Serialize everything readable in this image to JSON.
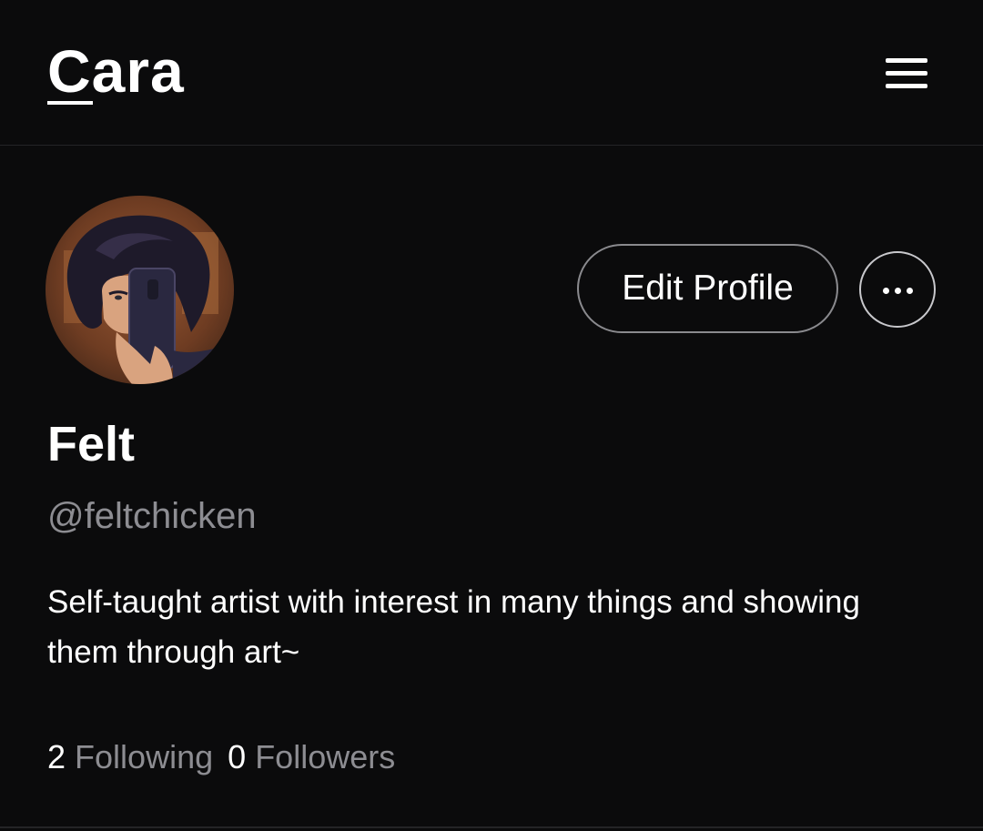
{
  "header": {
    "logo_text": "Cara",
    "menu_icon": "hamburger-menu-icon"
  },
  "profile": {
    "avatar_alt": "profile avatar",
    "display_name": "Felt",
    "handle": "@feltchicken",
    "bio": "Self-taught artist with interest in many things and showing them through art~",
    "edit_button_label": "Edit Profile",
    "more_icon": "more-options-icon",
    "following_count": "2",
    "following_label": "Following",
    "followers_count": "0",
    "followers_label": "Followers"
  },
  "colors": {
    "background": "#0b0b0c",
    "text_primary": "#ffffff",
    "text_secondary": "#8d8d92",
    "divider": "#242426"
  }
}
